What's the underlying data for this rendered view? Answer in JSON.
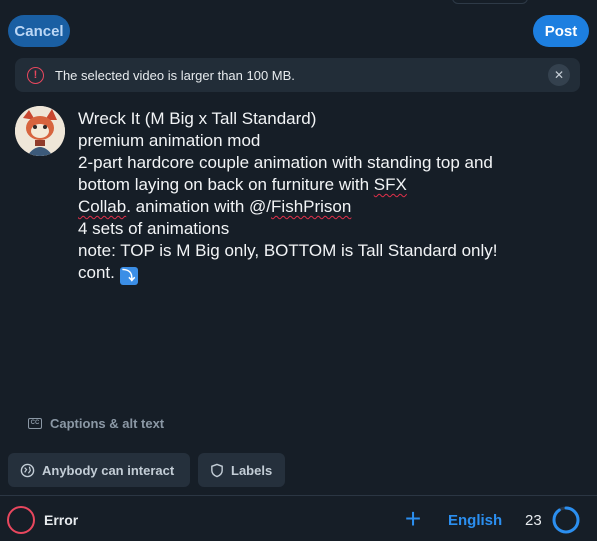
{
  "header": {
    "cancel_label": "Cancel",
    "post_label": "Post"
  },
  "banner": {
    "message": "The selected video is larger than 100 MB.",
    "icon": "alert-circle-icon",
    "close_icon": "close-icon"
  },
  "post": {
    "lines": [
      "Wreck It (M Big x Tall Standard)",
      "premium animation mod",
      "",
      "2-part hardcore couple animation with standing top and",
      "bottom laying on back on furniture with SFX",
      "",
      "Collab. animation with @/FishPrison",
      "",
      "4 sets of animations",
      "note: TOP is M Big only, BOTTOM is Tall Standard only!",
      "",
      "cont. ⤵️"
    ]
  },
  "captions_label": "Captions & alt text",
  "chips": {
    "interaction_label": "Anybody can interact",
    "labels_label": "Labels"
  },
  "footer": {
    "status_label": "Error",
    "language_label": "English",
    "char_count": "23",
    "char_progress_fraction": 0.9
  },
  "colors": {
    "background": "#161e27",
    "accent": "#1d7fe0",
    "error": "#e8475e"
  }
}
